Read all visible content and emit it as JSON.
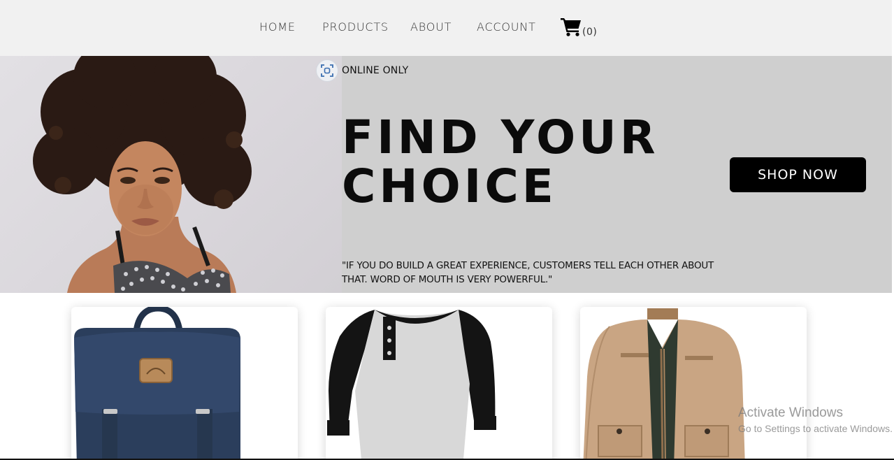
{
  "nav": {
    "links": [
      "HOME",
      "PRODUCTS",
      "ABOUT",
      "ACCOUNT"
    ],
    "cart_icon": "shopping-cart-icon",
    "cart_count": "(0)"
  },
  "hero": {
    "badge_icon": "scan-icon",
    "badge_text": "ONLINE ONLY",
    "title_line1": "FIND YOUR",
    "title_line2": "CHOICE",
    "quote": "\"IF YOU DO BUILD A GREAT EXPERIENCE, CUSTOMERS TELL EACH OTHER ABOUT THAT. WORD OF MOUTH IS VERY POWERFUL.\"",
    "cta_label": "SHOP NOW",
    "colors": {
      "background": "#cfcfcf",
      "cta_background": "#000000",
      "cta_text": "#ffffff"
    }
  },
  "products": [
    {
      "image": "navy-backpack"
    },
    {
      "image": "raglan-henley-shirt"
    },
    {
      "image": "tan-jacket"
    }
  ],
  "watermark": {
    "title": "Activate Windows",
    "subtitle": "Go to Settings to activate Windows."
  }
}
